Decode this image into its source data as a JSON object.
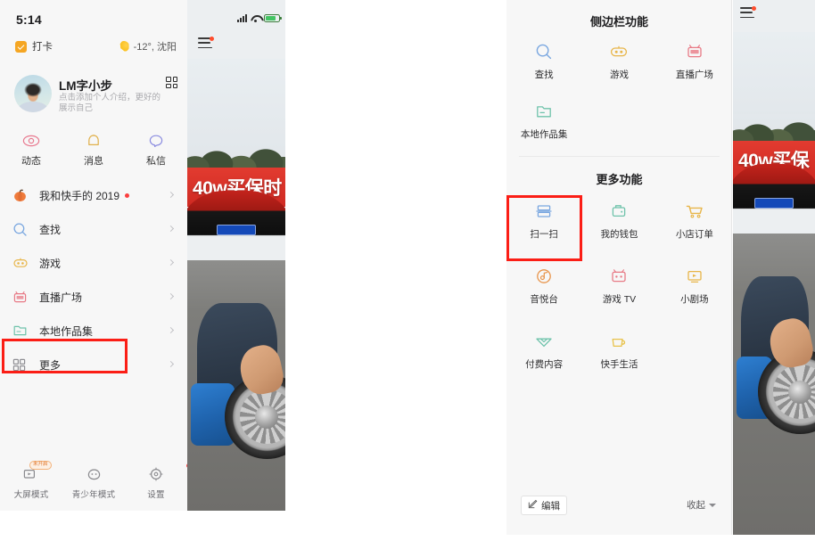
{
  "left_phone": {
    "status_bar": {
      "time": "5:14"
    },
    "checkin": {
      "label": "打卡",
      "icon": "checkmark-square-icon"
    },
    "weather": {
      "icon": "moon-icon",
      "text": "-12°, 沈阳"
    },
    "profile": {
      "name": "LM字小步",
      "description": "点击添加个人介绍，更好的展示自己",
      "qr_icon": "qr-code-icon",
      "avatar_icon": "user-avatar"
    },
    "quick_actions": [
      {
        "label": "动态",
        "icon": "eye-icon",
        "color": "#e8798f"
      },
      {
        "label": "消息",
        "icon": "bell-icon",
        "color": "#e0b04a"
      },
      {
        "label": "私信",
        "icon": "chat-bubble-icon",
        "color": "#8b8ce0"
      }
    ],
    "menu_items": [
      {
        "label": "我和快手的 2019",
        "icon": "pumpkin-icon",
        "color": "#e8713a",
        "dot": true
      },
      {
        "label": "查找",
        "icon": "search-icon",
        "color": "#7aa7e0",
        "dot": false
      },
      {
        "label": "游戏",
        "icon": "game-robot-icon",
        "color": "#e8b64a",
        "dot": false
      },
      {
        "label": "直播广场",
        "icon": "live-tv-icon",
        "color": "#e87a86",
        "dot": false
      },
      {
        "label": "本地作品集",
        "icon": "folder-icon",
        "color": "#6fc3ab",
        "dot": false
      },
      {
        "label": "更多",
        "icon": "grid-more-icon",
        "color": "#8e8e93",
        "dot": false
      }
    ],
    "bottom_bar": [
      {
        "label": "大屏模式",
        "icon": "screen-play-icon",
        "badge": "未开启",
        "dot": false
      },
      {
        "label": "青少年模式",
        "icon": "teen-face-icon",
        "badge": "",
        "dot": false
      },
      {
        "label": "设置",
        "icon": "gear-icon",
        "badge": "",
        "dot": true
      }
    ],
    "video": {
      "caption": "40w买保时"
    }
  },
  "right_panel": {
    "section1": {
      "title": "侧边栏功能",
      "items": [
        {
          "label": "查找",
          "icon": "search-icon",
          "color": "#7aa7e0"
        },
        {
          "label": "游戏",
          "icon": "game-robot-icon",
          "color": "#e8b64a"
        },
        {
          "label": "直播广场",
          "icon": "live-tv-icon",
          "color": "#e87a86"
        },
        {
          "label": "本地作品集",
          "icon": "folder-icon",
          "color": "#6fc3ab"
        }
      ]
    },
    "section2": {
      "title": "更多功能",
      "items": [
        {
          "label": "扫一扫",
          "icon": "scan-icon",
          "color": "#7aa7e0"
        },
        {
          "label": "我的钱包",
          "icon": "wallet-icon",
          "color": "#6fc3ab"
        },
        {
          "label": "小店订单",
          "icon": "shopping-cart-icon",
          "color": "#e8b64a"
        },
        {
          "label": "音悦台",
          "icon": "music-disc-icon",
          "color": "#e8944a"
        },
        {
          "label": "游戏 TV",
          "icon": "game-tv-icon",
          "color": "#e87a86"
        },
        {
          "label": "小剧场",
          "icon": "theater-screen-icon",
          "color": "#e8b64a"
        },
        {
          "label": "付费内容",
          "icon": "diamond-icon",
          "color": "#6fc3ab"
        },
        {
          "label": "快手生活",
          "icon": "coffee-cup-icon",
          "color": "#e8c24a"
        }
      ]
    },
    "footer": {
      "edit_label": "编辑",
      "edit_icon": "edit-pencil-icon",
      "collapse_label": "收起",
      "collapse_icon": "caret-down-icon"
    },
    "video": {
      "caption": "40w买保"
    }
  },
  "highlights": {
    "more_menu": "更多",
    "scan": "扫一扫",
    "color": "#fb1e16"
  }
}
